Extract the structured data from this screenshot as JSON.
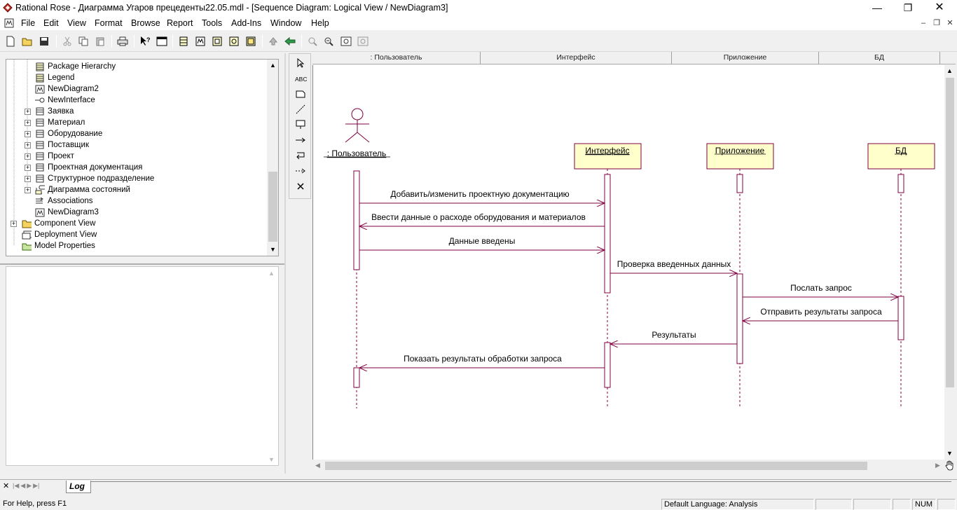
{
  "window": {
    "title": "Rational Rose - Диаграмма Угаров прецеденты22.05.mdl - [Sequence Diagram: Logical View / NewDiagram3]"
  },
  "menu": {
    "items": [
      "File",
      "Edit",
      "View",
      "Format",
      "Browse",
      "Report",
      "Tools",
      "Add-Ins",
      "Window",
      "Help"
    ]
  },
  "browser": {
    "items": [
      {
        "label": "Package Hierarchy",
        "icon": "class-diagram-icon"
      },
      {
        "label": "Legend",
        "icon": "class-diagram-icon"
      },
      {
        "label": "NewDiagram2",
        "icon": "collaboration-diagram-icon"
      },
      {
        "label": "NewInterface",
        "icon": "interface-icon"
      },
      {
        "label": "Заявка",
        "icon": "class-icon"
      },
      {
        "label": "Материал",
        "icon": "class-icon"
      },
      {
        "label": "Оборудование",
        "icon": "class-icon"
      },
      {
        "label": "Поставщик",
        "icon": "class-icon"
      },
      {
        "label": "Проект",
        "icon": "class-icon"
      },
      {
        "label": "Проектная документация",
        "icon": "class-icon"
      },
      {
        "label": "Структурное подразделение",
        "icon": "class-icon"
      },
      {
        "label": "Диаграмма состояний",
        "icon": "state-machine-icon"
      },
      {
        "label": "Associations",
        "icon": "associations-icon"
      },
      {
        "label": "NewDiagram3",
        "icon": "sequence-diagram-icon"
      },
      {
        "label": "Component View",
        "icon": "folder-icon"
      },
      {
        "label": "Deployment View",
        "icon": "deployment-icon"
      },
      {
        "label": "Model Properties",
        "icon": "properties-icon"
      }
    ]
  },
  "diagram": {
    "header": [
      ": Пользователь",
      "Интерфейс",
      "Приложение",
      "БД"
    ],
    "actor": ": Пользователь",
    "objects": [
      "Интерфейс",
      "Приложение",
      "БД"
    ],
    "messages": [
      "Добавить/изменить проектную документацию",
      "Ввести данные о расходе оборудования и материалов",
      "Данные введены",
      "Проверка введенных данных",
      "Послать запрос",
      "Отправить результаты запроса",
      "Результаты",
      "Показать результаты обработки запроса"
    ],
    "line_color": "#800040",
    "object_fill": "#ffffcc"
  },
  "log": {
    "tab_label": "Log"
  },
  "status": {
    "help": "For Help, press F1",
    "language": "Default Language: Analysis",
    "num": "NUM"
  }
}
